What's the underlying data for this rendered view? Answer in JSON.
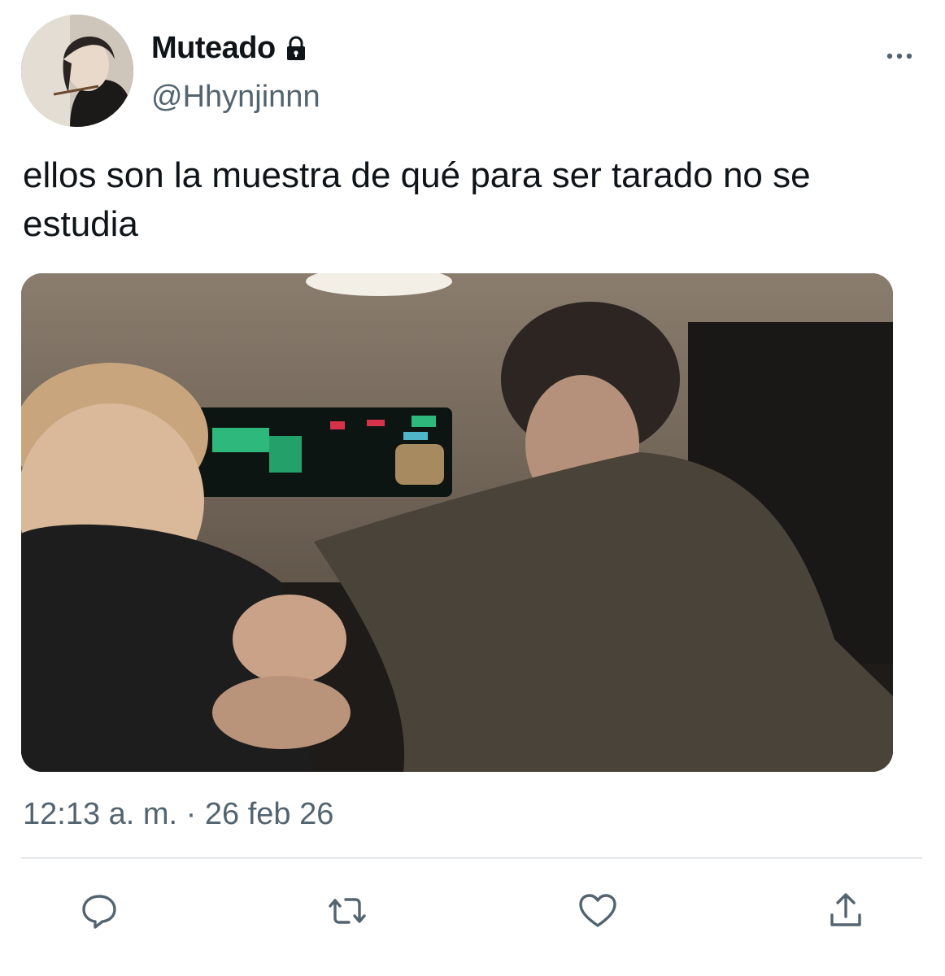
{
  "user": {
    "display_name": "Muteado",
    "handle": "@Hhynjinnn",
    "protected_icon": "lock-icon"
  },
  "tweet": {
    "text": "ellos son la muestra de qué para ser tarado no se estudia",
    "timestamp": "12:13 a. m. · 26 feb 26"
  },
  "actions": [
    {
      "name": "reply",
      "icon": "reply-icon"
    },
    {
      "name": "retweet",
      "icon": "retweet-icon"
    },
    {
      "name": "like",
      "icon": "heart-icon"
    },
    {
      "name": "share",
      "icon": "share-icon"
    }
  ],
  "colors": {
    "primary_text": "#0f1419",
    "secondary_text": "#536471",
    "divider": "#e6e9eb"
  }
}
